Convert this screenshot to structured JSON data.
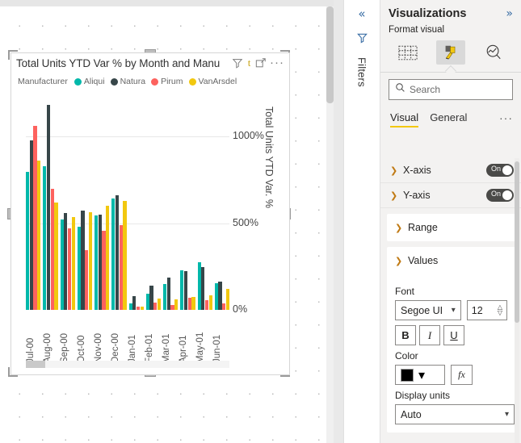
{
  "visual": {
    "title": "Total Units YTD Var % by Month and Manu",
    "toolbar": {
      "filter_icon": "filter-funnel-icon",
      "t_label": "t",
      "focus_icon": "focus-mode-icon",
      "more_label": "···"
    },
    "legend": {
      "title": "Manufacturer",
      "items": [
        {
          "label": "Aliqui",
          "color": "#01B8AA"
        },
        {
          "label": "Natura",
          "color": "#374649"
        },
        {
          "label": "Pirum",
          "color": "#FD625E"
        },
        {
          "label": "VanArsdel",
          "color": "#F2C80F"
        }
      ]
    }
  },
  "chart_data": {
    "type": "bar",
    "title": "Total Units YTD Var % by Month and Manu",
    "xlabel": "",
    "ylabel": "Total Units YTD Var. %",
    "ylim": [
      0,
      1200
    ],
    "yticks": [
      0,
      500,
      1000
    ],
    "ytick_labels": [
      "0%",
      "500%",
      "1000%"
    ],
    "grid": true,
    "legend_position": "top",
    "legend_title": "Manufacturer",
    "categories": [
      "Jul-00",
      "Aug-00",
      "Sep-00",
      "Oct-00",
      "Nov-00",
      "Dec-00",
      "Jan-01",
      "Feb-01",
      "Mar-01",
      "Apr-01",
      "May-01",
      "Jun-01"
    ],
    "series": [
      {
        "name": "Aliqui",
        "color": "#01B8AA",
        "values": [
          795,
          830,
          520,
          480,
          545,
          640,
          35,
          95,
          150,
          230,
          275,
          155
        ]
      },
      {
        "name": "Natura",
        "color": "#374649",
        "values": [
          975,
          1180,
          560,
          570,
          550,
          660,
          80,
          140,
          185,
          225,
          245,
          165
        ]
      },
      {
        "name": "Pirum",
        "color": "#FD625E",
        "values": [
          1060,
          700,
          470,
          345,
          455,
          490,
          18,
          40,
          30,
          70,
          55,
          35
        ]
      },
      {
        "name": "VanArsdel",
        "color": "#F2C80F",
        "values": [
          860,
          620,
          535,
          565,
          600,
          630,
          20,
          65,
          60,
          75,
          85,
          120
        ]
      }
    ]
  },
  "filters_rail": {
    "collapse_icon": "double-chevron-left-icon",
    "filter_icon": "filter-icon",
    "label": "Filters"
  },
  "viz_pane": {
    "title": "Visualizations",
    "expand_icon": "double-chevron-right-icon",
    "format_visual_label": "Format visual",
    "tabs": [
      {
        "name": "build-visual-tab",
        "icon": "fields-grid-icon",
        "active": false
      },
      {
        "name": "format-visual-tab",
        "icon": "paint-roller-icon",
        "active": true
      },
      {
        "name": "analytics-tab",
        "icon": "magnifier-chart-icon",
        "active": false
      }
    ],
    "search": {
      "placeholder": "Search",
      "value": "",
      "icon": "search-icon"
    },
    "sub_tabs": [
      {
        "label": "Visual",
        "active": true
      },
      {
        "label": "General",
        "active": false
      }
    ],
    "sub_tabs_more": "···",
    "sections": [
      {
        "name": "X-axis",
        "expanded": false,
        "toggle": "On"
      },
      {
        "name": "Y-axis",
        "expanded": true,
        "toggle": "On"
      }
    ],
    "range_card": {
      "label": "Range",
      "expanded": false
    },
    "values_card": {
      "label": "Values",
      "expanded": true,
      "font_label": "Font",
      "font_family": "Segoe UI",
      "font_size": "12",
      "bold": "B",
      "italic": "I",
      "underline": "U",
      "color_label": "Color",
      "color_value": "#000000",
      "fx_label": "fx",
      "display_units_label": "Display units",
      "display_units_value": "Auto"
    },
    "accent_color": "#F2C811"
  }
}
